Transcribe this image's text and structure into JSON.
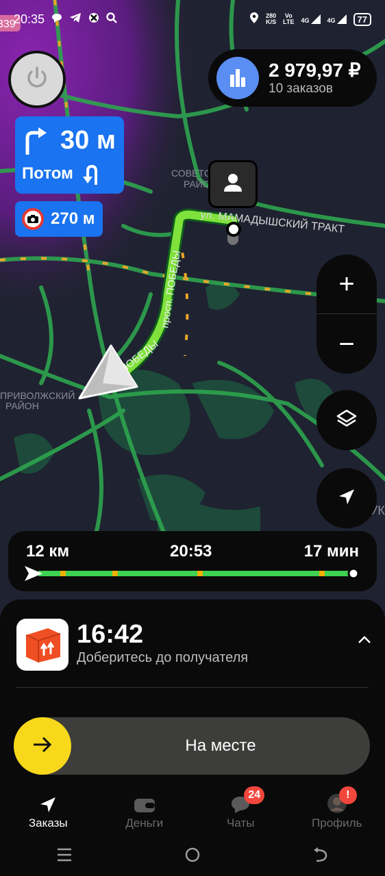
{
  "status_bar": {
    "time": "20:35",
    "speed_value": "280",
    "speed_unit": "K/S",
    "volte_top": "Vo",
    "volte_bottom": "LTE",
    "net1": "4G",
    "net2": "4G",
    "battery": "77",
    "left_icons": [
      "chat-bubble-icon",
      "telegram-icon",
      "app-icon",
      "search-icon"
    ],
    "right_icons": [
      "location-icon",
      "signal-icon",
      "battery-icon"
    ]
  },
  "earnings": {
    "amount": "2 979,97 ₽",
    "orders": "10 заказов",
    "icon": "stats-bars-icon"
  },
  "maneuver": {
    "distance": "30 м",
    "then_label": "Потом",
    "icon": "turn-right-icon",
    "then_icon": "u-turn-icon"
  },
  "speed_camera": {
    "distance": "270 м",
    "icon": "camera-icon"
  },
  "map": {
    "street_labels": [
      "ул. МАМАДЫШСКИЙ ТРАКТ",
      "просп. ПОБЕДЫ",
      "ПОБЕДЫ"
    ],
    "district_labels": [
      "СОВЕТСКИЙ",
      "РАЙОН",
      "ПРИВОЛЖСКИЙ",
      "РАЙОН",
      "УК"
    ],
    "road_badge": "339",
    "colors": {
      "route": "#7ee23a",
      "road": "#2ea44f",
      "traffic_jam": "#e8a52a",
      "background": "#1f2230",
      "purple_zone": "#7a1f9e"
    }
  },
  "controls": {
    "zoom_in": "+",
    "zoom_out": "−",
    "layers_icon": "layers-icon",
    "locate_icon": "navigation-arrow-icon"
  },
  "route_progress": {
    "distance": "12 км",
    "arrival": "20:53",
    "duration": "17 мин"
  },
  "order": {
    "time": "16:42",
    "subtitle": "Доберитесь до получателя",
    "icon": "package-box-icon"
  },
  "slider": {
    "label": "На месте",
    "icon": "arrow-right-icon"
  },
  "bottom_nav": {
    "items": [
      {
        "label": "Заказы",
        "icon": "navigation-arrow-icon",
        "active": true
      },
      {
        "label": "Деньги",
        "icon": "wallet-icon",
        "active": false
      },
      {
        "label": "Чаты",
        "icon": "chat-bubble-icon",
        "active": false,
        "badge": "24"
      },
      {
        "label": "Профиль",
        "icon": "avatar-icon",
        "active": false,
        "badge": "!"
      }
    ]
  },
  "system_nav": [
    "menu-icon",
    "home-icon",
    "back-icon"
  ]
}
